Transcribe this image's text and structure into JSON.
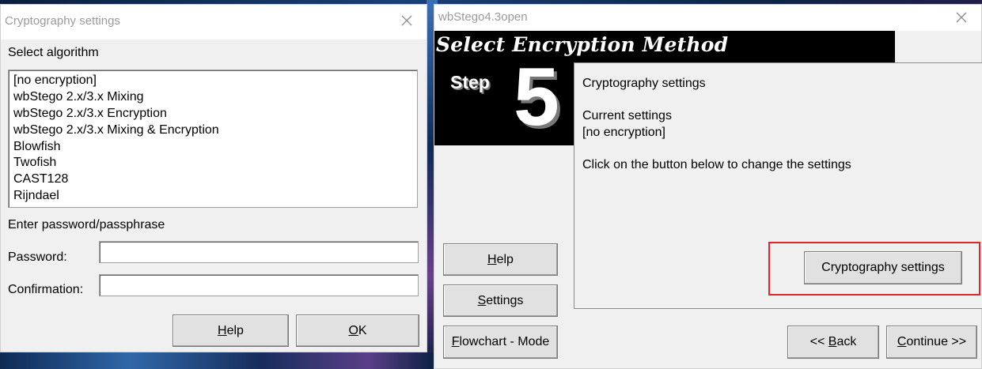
{
  "crypto_dialog": {
    "title": "Cryptography settings",
    "select_algorithm_label": "Select algorithm",
    "algorithms": [
      "[no encryption]",
      "wbStego 2.x/3.x Mixing",
      "wbStego 2.x/3.x Encryption",
      "wbStego 2.x/3.x Mixing & Encryption",
      "Blowfish",
      "Twofish",
      "CAST128",
      "Rijndael"
    ],
    "password_section_label": "Enter password/passphrase",
    "password_label": "Password:",
    "password_value": "",
    "confirmation_label": "Confirmation:",
    "confirmation_value": "",
    "help_button": {
      "accel": "H",
      "rest": "elp"
    },
    "ok_button": {
      "accel": "O",
      "rest": "K"
    }
  },
  "wizard": {
    "title": "wbStego4.3open",
    "header_title": "Select Encryption Method",
    "step_label": "Step",
    "step_number": "5",
    "content": {
      "heading": "Cryptography settings",
      "current_settings_label": "Current settings",
      "current_settings_value": "[no encryption]",
      "instruction": "Click on the button below to change the settings"
    },
    "crypto_settings_button": "Cryptography settings",
    "help_button": {
      "accel": "H",
      "rest": "elp"
    },
    "settings_button": {
      "accel": "S",
      "rest": "ettings"
    },
    "flowchart_button": {
      "accel": "F",
      "rest": "lowchart - Mode"
    },
    "back_button": {
      "pre": "<< ",
      "accel": "B",
      "rest": "ack"
    },
    "continue_button": {
      "accel": "C",
      "rest": "ontinue >>"
    }
  },
  "colors": {
    "highlight": "#e0262b",
    "header_bg": "#000000",
    "window_bg": "#f0f0f0"
  }
}
